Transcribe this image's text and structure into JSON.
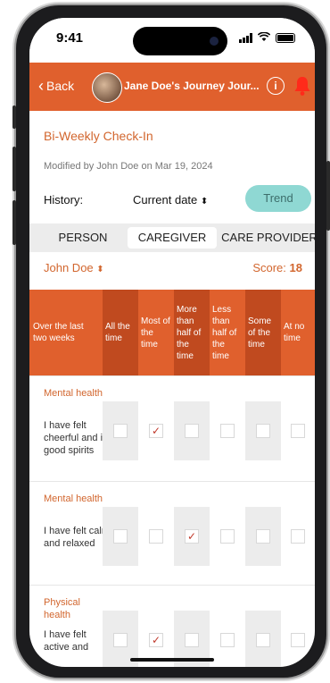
{
  "status_bar": {
    "time": "9:41"
  },
  "app_bar": {
    "back_label": "Back",
    "title": "Jane Doe's Journey Jour...",
    "info_glyph": "i"
  },
  "page": {
    "title": "Bi-Weekly Check-In",
    "modified": "Modified by John Doe on Mar 19, 2024",
    "history_label": "History:",
    "history_value": "Current date",
    "trend_label": "Trend"
  },
  "tabs": [
    "PERSON",
    "CAREGIVER",
    "CARE PROVIDER"
  ],
  "active_tab": "CAREGIVER",
  "person": {
    "name": "John Doe",
    "score_label": "Score:",
    "score_value": "18"
  },
  "table": {
    "headers": [
      "Over the last two weeks",
      "All the time",
      "Most of the time",
      "More than half of the time",
      "Less than half of the time",
      "Some of the time",
      "At no time"
    ],
    "rows": [
      {
        "category": "Mental health",
        "statement": "I have felt cheerful and in good spirits",
        "selected": 1
      },
      {
        "category": "Mental health",
        "statement": "I have felt calm and relaxed",
        "selected": 2
      },
      {
        "category": "Physical health",
        "statement": "I have felt active and",
        "selected": 1
      }
    ]
  },
  "colors": {
    "accent": "#e0602d",
    "accent_dark": "#c04a1f",
    "trend": "#8fd8d3",
    "text_accent": "#d2662e"
  },
  "icons": {
    "back": "chevron-left-icon",
    "info": "info-icon",
    "bell": "bell-icon",
    "sort": "sort-updown-icon",
    "check": "checkmark-icon"
  }
}
